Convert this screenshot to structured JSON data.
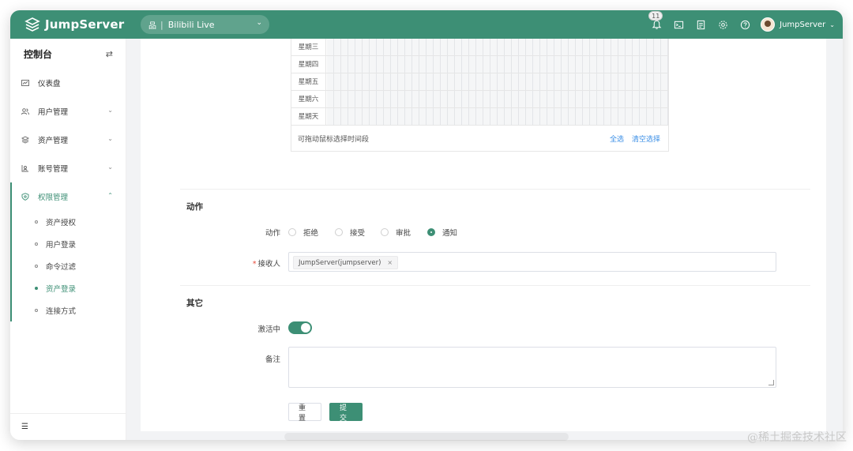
{
  "header": {
    "logo_text": "JumpServer",
    "org_name": "Bilibili Live",
    "notification_count": "11",
    "username": "JumpServer",
    "icons": [
      "bell-icon",
      "terminal-icon",
      "ticket-icon",
      "settings-icon",
      "help-icon"
    ]
  },
  "sidebar": {
    "title": "控制台",
    "items": [
      {
        "label": "仪表盘",
        "icon": "dashboard-icon"
      },
      {
        "label": "用户管理",
        "icon": "users-icon"
      },
      {
        "label": "资产管理",
        "icon": "assets-icon"
      },
      {
        "label": "账号管理",
        "icon": "accounts-icon"
      },
      {
        "label": "权限管理",
        "icon": "shield-icon"
      }
    ],
    "sub_items": [
      {
        "label": "资产授权"
      },
      {
        "label": "用户登录"
      },
      {
        "label": "命令过滤"
      },
      {
        "label": "资产登录"
      },
      {
        "label": "连接方式"
      }
    ]
  },
  "time_grid": {
    "days": [
      "星期三",
      "星期四",
      "星期五",
      "星期六",
      "星期天"
    ],
    "hint": "可拖动鼠标选择时间段",
    "select_all": "全选",
    "clear": "清空选择"
  },
  "action_section": {
    "title": "动作",
    "action_label": "动作",
    "options": [
      "拒绝",
      "接受",
      "审批",
      "通知"
    ],
    "selected": "通知",
    "receiver_label": "接收人",
    "receiver_tag": "JumpServer(jumpserver)",
    "tag_close": "×"
  },
  "other_section": {
    "title": "其它",
    "active_label": "激活中",
    "active": true,
    "comment_label": "备注",
    "comment_value": ""
  },
  "buttons": {
    "reset": "重置",
    "submit": "提交"
  },
  "watermark": "@稀土掘金技术社区",
  "colors": {
    "brand": "#3d8f75",
    "link": "#3a8ee6",
    "required": "#e74c3c"
  }
}
